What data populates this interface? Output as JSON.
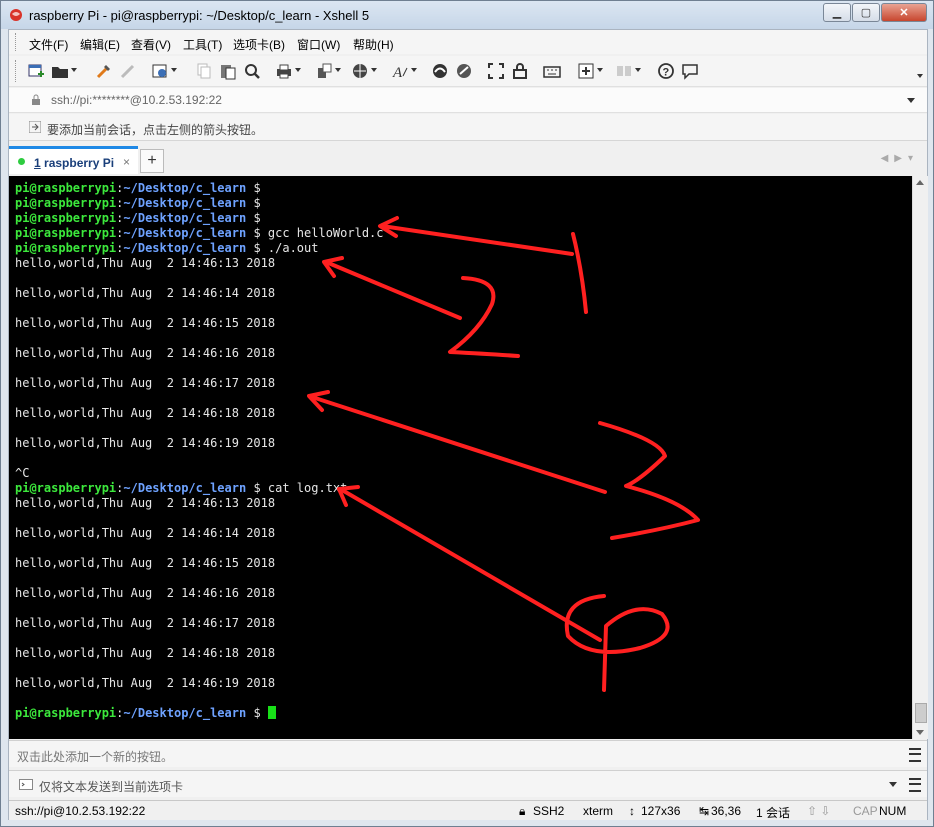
{
  "window": {
    "title": "raspberry Pi - pi@raspberrypi: ~/Desktop/c_learn - Xshell 5"
  },
  "menubar": {
    "items": [
      "文件(F)",
      "编辑(E)",
      "查看(V)",
      "工具(T)",
      "选项卡(B)",
      "窗口(W)",
      "帮助(H)"
    ]
  },
  "address": {
    "value": "ssh://pi:********@10.2.53.192:22"
  },
  "hint": {
    "text": "要添加当前会话，点击左侧的箭头按钮。"
  },
  "tab": {
    "number": "1",
    "label": " raspberry Pi",
    "close": "×",
    "add": "+"
  },
  "terminal": {
    "prompt_user": "pi@raspberrypi",
    "prompt_sep": ":",
    "prompt_path": "~/Desktop/c_learn",
    "prompt_symbol": " $ ",
    "lines": [
      {
        "type": "prompt",
        "cmd": ""
      },
      {
        "type": "prompt",
        "cmd": ""
      },
      {
        "type": "prompt",
        "cmd": ""
      },
      {
        "type": "prompt",
        "cmd": "gcc helloWorld.c"
      },
      {
        "type": "prompt",
        "cmd": "./a.out"
      },
      {
        "type": "text",
        "text": "hello,world,Thu Aug  2 14:46:13 2018"
      },
      {
        "type": "text",
        "text": ""
      },
      {
        "type": "text",
        "text": "hello,world,Thu Aug  2 14:46:14 2018"
      },
      {
        "type": "text",
        "text": ""
      },
      {
        "type": "text",
        "text": "hello,world,Thu Aug  2 14:46:15 2018"
      },
      {
        "type": "text",
        "text": ""
      },
      {
        "type": "text",
        "text": "hello,world,Thu Aug  2 14:46:16 2018"
      },
      {
        "type": "text",
        "text": ""
      },
      {
        "type": "text",
        "text": "hello,world,Thu Aug  2 14:46:17 2018"
      },
      {
        "type": "text",
        "text": ""
      },
      {
        "type": "text",
        "text": "hello,world,Thu Aug  2 14:46:18 2018"
      },
      {
        "type": "text",
        "text": ""
      },
      {
        "type": "text",
        "text": "hello,world,Thu Aug  2 14:46:19 2018"
      },
      {
        "type": "text",
        "text": ""
      },
      {
        "type": "text",
        "text": "^C"
      },
      {
        "type": "prompt",
        "cmd": "cat log.txt"
      },
      {
        "type": "text",
        "text": "hello,world,Thu Aug  2 14:46:13 2018"
      },
      {
        "type": "text",
        "text": ""
      },
      {
        "type": "text",
        "text": "hello,world,Thu Aug  2 14:46:14 2018"
      },
      {
        "type": "text",
        "text": ""
      },
      {
        "type": "text",
        "text": "hello,world,Thu Aug  2 14:46:15 2018"
      },
      {
        "type": "text",
        "text": ""
      },
      {
        "type": "text",
        "text": "hello,world,Thu Aug  2 14:46:16 2018"
      },
      {
        "type": "text",
        "text": ""
      },
      {
        "type": "text",
        "text": "hello,world,Thu Aug  2 14:46:17 2018"
      },
      {
        "type": "text",
        "text": ""
      },
      {
        "type": "text",
        "text": "hello,world,Thu Aug  2 14:46:18 2018"
      },
      {
        "type": "text",
        "text": ""
      },
      {
        "type": "text",
        "text": "hello,world,Thu Aug  2 14:46:19 2018"
      },
      {
        "type": "text",
        "text": ""
      },
      {
        "type": "prompt",
        "cmd": "",
        "cursor": true
      }
    ]
  },
  "quickbar": {
    "text": "双击此处添加一个新的按钮。"
  },
  "sendbar": {
    "text": "仅将文本发送到当前选项卡"
  },
  "status": {
    "connection": "ssh://pi@10.2.53.192:22",
    "protocol": "SSH2",
    "terminal_type": "xterm",
    "size": "127x36",
    "cursor_pos": "36,36",
    "sessions": "1 会话",
    "cap": "CAP",
    "num": "NUM"
  },
  "colors": {
    "prompt_user": "#3ce83c",
    "prompt_path": "#6ea2ff",
    "annotation": "#ff2020",
    "tab_accent": "#1e88e5"
  },
  "annotations": [
    "1",
    "2",
    "3",
    "4"
  ]
}
